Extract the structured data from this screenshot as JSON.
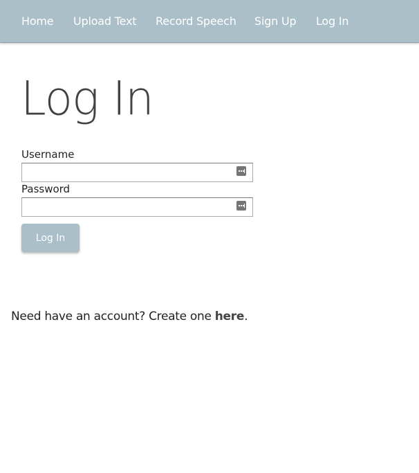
{
  "nav": {
    "items": [
      {
        "label": "Home"
      },
      {
        "label": "Upload Text"
      },
      {
        "label": "Record Speech"
      },
      {
        "label": "Sign Up"
      },
      {
        "label": "Log In"
      }
    ]
  },
  "page": {
    "title": "Log In"
  },
  "form": {
    "username_label": "Username",
    "username_value": "",
    "password_label": "Password",
    "password_value": "",
    "submit_label": "Log In",
    "password_manager_icon": "key-autofill-icon"
  },
  "footer": {
    "prompt_text": "Need have an account? Create one ",
    "link_text": "here",
    "trailing": "."
  },
  "colors": {
    "nav_background": "#aabfc8",
    "button_background": "#aabfc8",
    "nav_text": "#ffffff"
  }
}
